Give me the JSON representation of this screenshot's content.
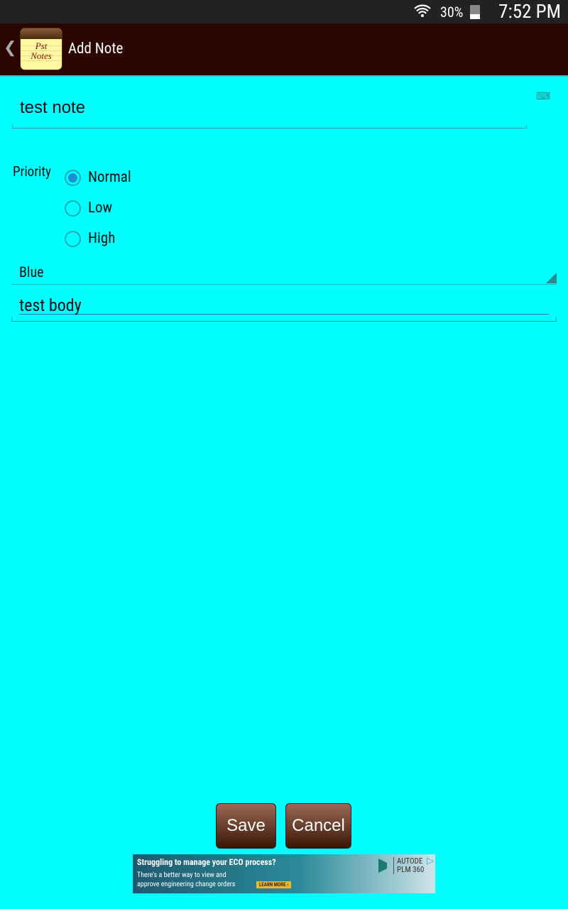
{
  "status_bar": {
    "battery": "30%",
    "time": "7:52 PM",
    "icons": [
      "wifi-icon",
      "battery-icon"
    ]
  },
  "action_bar": {
    "title": "Add Note",
    "logo_text": "Pst Notes",
    "back_icon": "chevron-left-icon"
  },
  "form": {
    "title_value": "test note",
    "priority_label": "Priority",
    "priority_options": [
      {
        "label": "Normal",
        "selected": true
      },
      {
        "label": "Low",
        "selected": false
      },
      {
        "label": "High",
        "selected": false
      }
    ],
    "color_selected": "Blue",
    "body_value": "test body"
  },
  "buttons": {
    "save": "Save",
    "cancel": "Cancel"
  },
  "ad": {
    "headline": "Struggling to manage your ECO process?",
    "line1": "There's a better way to view and",
    "line2": "approve engineering change orders",
    "cta": "LEARN MORE ›",
    "brand1": "AUTODE",
    "brand2": "PLM 360"
  },
  "colors": {
    "background": "#00ffff",
    "action_bar": "#2b0500",
    "radio_accent": "#1b8fd0"
  }
}
